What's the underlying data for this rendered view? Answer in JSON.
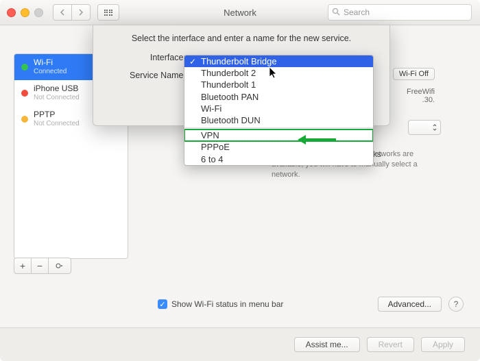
{
  "window_title": "Network",
  "search_placeholder": "Search",
  "sidebar": {
    "items": [
      {
        "name": "Wi-Fi",
        "status": "Connected",
        "color": "green"
      },
      {
        "name": "iPhone USB",
        "status": "Not Connected",
        "color": "red"
      },
      {
        "name": "PPTP",
        "status": "Not Connected",
        "color": "yellow"
      }
    ]
  },
  "sheet": {
    "prompt": "Select the interface and enter a name for the new service.",
    "interface_label": "Interface:",
    "service_name_label": "Service Name:"
  },
  "dropdown": {
    "options": [
      "Thunderbolt Bridge",
      "Thunderbolt 2",
      "Thunderbolt 1",
      "Bluetooth PAN",
      "Wi-Fi",
      "Bluetooth DUN",
      "VPN",
      "PPPoE",
      "6 to 4"
    ],
    "selected": "Thunderbolt Bridge",
    "highlighted": "VPN"
  },
  "right": {
    "wifi_off_label": "Wi-Fi Off",
    "freewifi": "FreeWifi",
    "ip_suffix": ".30.",
    "net_heading": "rks",
    "desc": "ed automatically. If no known networks are available, you will have to manually select a network."
  },
  "show_status_label": "Show Wi-Fi status in menu bar",
  "advanced_label": "Advanced...",
  "footer": {
    "assist": "Assist me...",
    "revert": "Revert",
    "apply": "Apply"
  }
}
